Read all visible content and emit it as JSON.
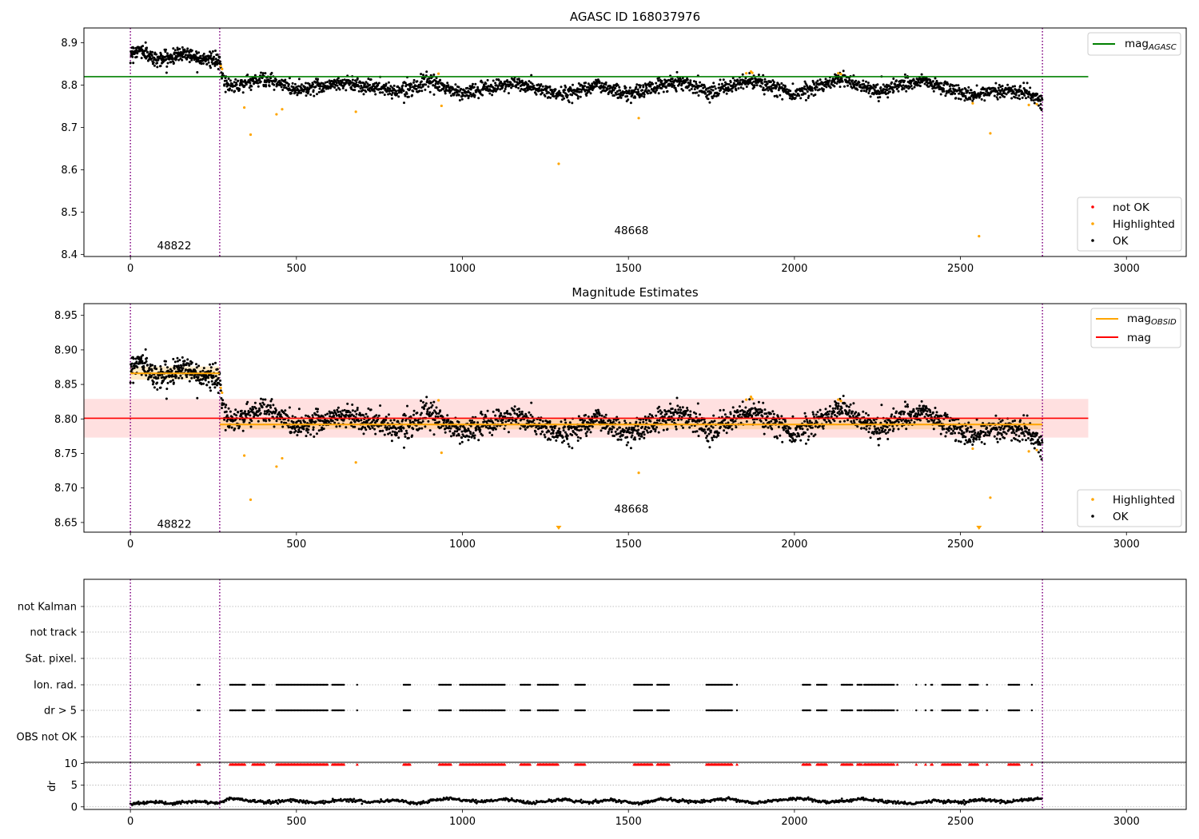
{
  "chart_data": [
    {
      "type": "scatter",
      "title": "AGASC ID 168037976",
      "xlim": [
        -140,
        3180
      ],
      "ylim": [
        8.395,
        8.935
      ],
      "xticks": [
        0,
        500,
        1000,
        1500,
        2000,
        2500,
        3000
      ],
      "yticks": [
        8.4,
        8.5,
        8.6,
        8.7,
        8.8,
        8.9
      ],
      "ytick_labels": [
        "8.4",
        "8.5",
        "8.6",
        "8.7",
        "8.8",
        "8.9"
      ],
      "obsid_boundaries": [
        0,
        269,
        2747
      ],
      "obsid_labels": [
        {
          "x": 132,
          "y": 8.42,
          "text": "48822"
        },
        {
          "x": 1509,
          "y": 8.455,
          "text": "48668"
        }
      ],
      "reference_line": {
        "name": "mag",
        "subscript": "AGASC",
        "y": 8.82,
        "x": [
          -140,
          2885
        ],
        "color": "#008000"
      },
      "legend_lines": [
        {
          "name": "mag",
          "subscript": "AGASC",
          "color": "#008000"
        }
      ],
      "legend_points": [
        {
          "name": "not OK",
          "color": "#ff0000"
        },
        {
          "name": "Highlighted",
          "color": "#ffa500"
        },
        {
          "name": "OK",
          "color": "#000000"
        }
      ],
      "highlighted_points": [
        [
          272,
          8.845
        ],
        [
          276,
          8.838
        ],
        [
          343,
          8.747
        ],
        [
          362,
          8.683
        ],
        [
          440,
          8.731
        ],
        [
          457,
          8.743
        ],
        [
          679,
          8.737
        ],
        [
          928,
          8.827
        ],
        [
          937,
          8.751
        ],
        [
          1290,
          8.614
        ],
        [
          1531,
          8.722
        ],
        [
          1855,
          8.828
        ],
        [
          1869,
          8.832
        ],
        [
          1873,
          8.829
        ],
        [
          2132,
          8.828
        ],
        [
          2140,
          8.826
        ],
        [
          2537,
          8.757
        ],
        [
          2556,
          8.443
        ],
        [
          2590,
          8.686
        ],
        [
          2706,
          8.753
        ],
        [
          2730,
          8.755
        ]
      ],
      "ok_series": [
        {
          "x_range": [
            0,
            269
          ],
          "anchors": [
            [
              0,
              8.876
            ],
            [
              30,
              8.884
            ],
            [
              70,
              8.862
            ],
            [
              120,
              8.864
            ],
            [
              160,
              8.877
            ],
            [
              200,
              8.866
            ],
            [
              240,
              8.861
            ],
            [
              262,
              8.856
            ],
            [
              269,
              8.852
            ]
          ],
          "noise": 0.0085,
          "count": 320
        },
        {
          "x_range": [
            269,
            2747
          ],
          "anchors": [
            [
              269,
              8.85
            ],
            [
              282,
              8.81
            ],
            [
              300,
              8.797
            ],
            [
              400,
              8.815
            ],
            [
              500,
              8.79
            ],
            [
              650,
              8.806
            ],
            [
              800,
              8.786
            ],
            [
              900,
              8.807
            ],
            [
              1000,
              8.78
            ],
            [
              1150,
              8.805
            ],
            [
              1300,
              8.777
            ],
            [
              1400,
              8.801
            ],
            [
              1500,
              8.779
            ],
            [
              1650,
              8.81
            ],
            [
              1750,
              8.785
            ],
            [
              1870,
              8.81
            ],
            [
              2000,
              8.78
            ],
            [
              2140,
              8.815
            ],
            [
              2250,
              8.786
            ],
            [
              2380,
              8.81
            ],
            [
              2500,
              8.782
            ],
            [
              2540,
              8.772
            ],
            [
              2600,
              8.79
            ],
            [
              2700,
              8.781
            ],
            [
              2747,
              8.76
            ]
          ],
          "noise": 0.0085,
          "count": 2300
        }
      ],
      "not_ok_points": []
    },
    {
      "type": "scatter",
      "title": "Magnitude Estimates",
      "xlim": [
        -140,
        3180
      ],
      "ylim": [
        8.636,
        8.967
      ],
      "xticks": [
        0,
        500,
        1000,
        1500,
        2000,
        2500,
        3000
      ],
      "yticks": [
        8.65,
        8.7,
        8.75,
        8.8,
        8.85,
        8.9,
        8.95
      ],
      "ytick_labels": [
        "8.65",
        "8.70",
        "8.75",
        "8.80",
        "8.85",
        "8.90",
        "8.95"
      ],
      "obsid_boundaries": [
        0,
        269,
        2747
      ],
      "obsid_labels": [
        {
          "x": 132,
          "y": 8.647,
          "text": "48822"
        },
        {
          "x": 1509,
          "y": 8.669,
          "text": "48668"
        }
      ],
      "mag_band": {
        "y": 8.801,
        "low": 8.773,
        "high": 8.829,
        "x": [
          -140,
          2885
        ],
        "color": "#ff0000"
      },
      "obsid_mag_segments": [
        {
          "x": [
            0,
            269
          ],
          "y": 8.866,
          "low": 8.857,
          "high": 8.876
        },
        {
          "x": [
            269,
            2747
          ],
          "y": 8.792,
          "low": 8.785,
          "high": 8.8
        }
      ],
      "legend_lines": [
        {
          "name": "mag",
          "subscript": "OBSID",
          "color": "#ffa500"
        },
        {
          "name": "mag",
          "subscript": "",
          "color": "#ff0000"
        }
      ],
      "legend_points": [
        {
          "name": "Highlighted",
          "color": "#ffa500"
        },
        {
          "name": "OK",
          "color": "#000000"
        }
      ],
      "highlighted_points": [
        [
          272,
          8.845
        ],
        [
          276,
          8.838
        ],
        [
          343,
          8.747
        ],
        [
          362,
          8.683
        ],
        [
          440,
          8.731
        ],
        [
          457,
          8.743
        ],
        [
          679,
          8.737
        ],
        [
          928,
          8.827
        ],
        [
          937,
          8.751
        ],
        [
          1531,
          8.722
        ],
        [
          1855,
          8.828
        ],
        [
          1869,
          8.832
        ],
        [
          1873,
          8.829
        ],
        [
          2132,
          8.828
        ],
        [
          2140,
          8.826
        ],
        [
          2537,
          8.757
        ],
        [
          2590,
          8.686
        ],
        [
          2706,
          8.753
        ],
        [
          2730,
          8.755
        ]
      ],
      "out_of_range_markers": [
        [
          1290,
          8.64
        ],
        [
          2556,
          8.64
        ]
      ],
      "ok_series": [
        {
          "x_range": [
            0,
            269
          ],
          "anchors": [
            [
              0,
              8.876
            ],
            [
              30,
              8.884
            ],
            [
              70,
              8.862
            ],
            [
              120,
              8.864
            ],
            [
              160,
              8.877
            ],
            [
              200,
              8.866
            ],
            [
              240,
              8.861
            ],
            [
              262,
              8.856
            ],
            [
              269,
              8.852
            ]
          ],
          "noise": 0.0085,
          "count": 320
        },
        {
          "x_range": [
            269,
            2747
          ],
          "anchors": [
            [
              269,
              8.85
            ],
            [
              282,
              8.81
            ],
            [
              300,
              8.797
            ],
            [
              400,
              8.815
            ],
            [
              500,
              8.79
            ],
            [
              650,
              8.806
            ],
            [
              800,
              8.786
            ],
            [
              900,
              8.807
            ],
            [
              1000,
              8.78
            ],
            [
              1150,
              8.805
            ],
            [
              1300,
              8.777
            ],
            [
              1400,
              8.801
            ],
            [
              1500,
              8.779
            ],
            [
              1650,
              8.81
            ],
            [
              1750,
              8.785
            ],
            [
              1870,
              8.81
            ],
            [
              2000,
              8.78
            ],
            [
              2140,
              8.815
            ],
            [
              2250,
              8.786
            ],
            [
              2380,
              8.81
            ],
            [
              2500,
              8.782
            ],
            [
              2540,
              8.772
            ],
            [
              2600,
              8.79
            ],
            [
              2700,
              8.781
            ],
            [
              2747,
              8.76
            ]
          ],
          "noise": 0.0085,
          "count": 2300
        }
      ]
    },
    {
      "type": "scatter",
      "title": "",
      "xlim": [
        -140,
        3180
      ],
      "xticks": [
        0,
        500,
        1000,
        1500,
        2000,
        2500,
        3000
      ],
      "obsid_boundaries": [
        0,
        269,
        2747
      ],
      "flag_rows": [
        {
          "label": "not Kalman",
          "segments": []
        },
        {
          "label": "not track",
          "segments": []
        },
        {
          "label": "Sat. pixel.",
          "segments": []
        },
        {
          "label": "Ion. rad.",
          "segments": [
            [
              202,
              209
            ],
            [
              300,
              345
            ],
            [
              368,
              405
            ],
            [
              440,
              595
            ],
            [
              608,
              645
            ],
            [
              683,
              686
            ],
            [
              823,
              843
            ],
            [
              930,
              967
            ],
            [
              993,
              1130
            ],
            [
              1175,
              1207
            ],
            [
              1227,
              1290
            ],
            [
              1340,
              1372
            ],
            [
              1517,
              1572
            ],
            [
              1587,
              1623
            ],
            [
              1735,
              1812
            ],
            [
              1827,
              1830
            ],
            [
              2025,
              2050
            ],
            [
              2068,
              2098
            ],
            [
              2142,
              2177
            ],
            [
              2190,
              2205
            ],
            [
              2210,
              2300
            ],
            [
              2310,
              2313
            ],
            [
              2367,
              2370
            ],
            [
              2395,
              2398
            ],
            [
              2412,
              2417
            ],
            [
              2445,
              2500
            ],
            [
              2527,
              2555
            ],
            [
              2580,
              2583
            ],
            [
              2645,
              2680
            ],
            [
              2715,
              2718
            ]
          ]
        },
        {
          "label": "dr > 5",
          "segments": [
            [
              202,
              209
            ],
            [
              300,
              345
            ],
            [
              368,
              405
            ],
            [
              440,
              595
            ],
            [
              608,
              645
            ],
            [
              683,
              686
            ],
            [
              823,
              843
            ],
            [
              930,
              967
            ],
            [
              993,
              1130
            ],
            [
              1175,
              1207
            ],
            [
              1227,
              1290
            ],
            [
              1340,
              1372
            ],
            [
              1517,
              1572
            ],
            [
              1587,
              1623
            ],
            [
              1735,
              1812
            ],
            [
              1827,
              1830
            ],
            [
              2025,
              2050
            ],
            [
              2068,
              2098
            ],
            [
              2142,
              2177
            ],
            [
              2190,
              2205
            ],
            [
              2210,
              2300
            ],
            [
              2310,
              2313
            ],
            [
              2367,
              2370
            ],
            [
              2395,
              2398
            ],
            [
              2412,
              2417
            ],
            [
              2445,
              2500
            ],
            [
              2527,
              2555
            ],
            [
              2580,
              2583
            ],
            [
              2645,
              2680
            ],
            [
              2715,
              2718
            ]
          ]
        },
        {
          "label": "OBS not OK",
          "segments": []
        }
      ],
      "dr": {
        "ylabel": "dr",
        "ylim": [
          -0.6,
          10.3
        ],
        "yticks": [
          0,
          5,
          10
        ],
        "ytick_labels": [
          "0",
          "5",
          "10"
        ],
        "clipped_value": 9.8,
        "clipped_color": "#ff0000",
        "baseline_anchors": [
          [
            0,
            0.7
          ],
          [
            60,
            1.1
          ],
          [
            120,
            0.8
          ],
          [
            200,
            1.2
          ],
          [
            269,
            0.9
          ],
          [
            300,
            2.0
          ],
          [
            350,
            1.5
          ],
          [
            420,
            1.0
          ],
          [
            480,
            1.6
          ],
          [
            560,
            0.9
          ],
          [
            640,
            1.7
          ],
          [
            720,
            1.1
          ],
          [
            800,
            1.6
          ],
          [
            860,
            0.8
          ],
          [
            950,
            1.9
          ],
          [
            1050,
            1.2
          ],
          [
            1130,
            1.8
          ],
          [
            1200,
            0.9
          ],
          [
            1300,
            1.7
          ],
          [
            1380,
            1.0
          ],
          [
            1450,
            1.6
          ],
          [
            1530,
            0.8
          ],
          [
            1600,
            1.8
          ],
          [
            1700,
            1.1
          ],
          [
            1800,
            1.9
          ],
          [
            1880,
            0.9
          ],
          [
            1950,
            1.6
          ],
          [
            2030,
            1.9
          ],
          [
            2100,
            1.0
          ],
          [
            2200,
            1.8
          ],
          [
            2280,
            1.2
          ],
          [
            2360,
            0.7
          ],
          [
            2420,
            1.5
          ],
          [
            2500,
            1.0
          ],
          [
            2560,
            1.7
          ],
          [
            2640,
            1.1
          ],
          [
            2700,
            1.6
          ],
          [
            2747,
            1.9
          ]
        ]
      }
    }
  ]
}
